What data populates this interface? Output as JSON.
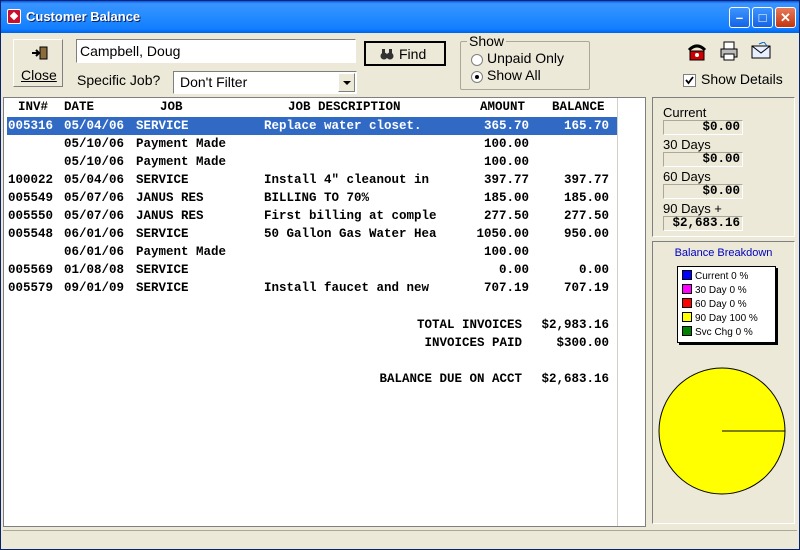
{
  "window": {
    "title": "Customer Balance"
  },
  "toolbar": {
    "close_label": "Close",
    "customer_name": "Campbell, Doug",
    "find_label": "Find",
    "specific_job_label": "Specific Job?",
    "job_filter_value": "Don't Filter",
    "show_group_label": "Show",
    "show_options": [
      "Unpaid Only",
      "Show All"
    ],
    "show_details_label": "Show Details"
  },
  "table": {
    "headers": {
      "inv": "INV#",
      "date": "DATE",
      "job": "JOB",
      "desc": "JOB DESCRIPTION",
      "amount": "AMOUNT",
      "balance": "BALANCE"
    },
    "rows": [
      {
        "inv": "005316",
        "date": "05/04/06",
        "job": "SERVICE",
        "desc": "Replace water closet.",
        "amount": "365.70",
        "balance": "165.70"
      },
      {
        "inv": "",
        "date": "05/10/06",
        "job": "Payment Made",
        "desc": "",
        "amount": "100.00",
        "balance": ""
      },
      {
        "inv": "",
        "date": "05/10/06",
        "job": "Payment Made",
        "desc": "",
        "amount": "100.00",
        "balance": ""
      },
      {
        "inv": "100022",
        "date": "05/04/06",
        "job": "SERVICE",
        "desc": "Install 4\" cleanout in",
        "amount": "397.77",
        "balance": "397.77"
      },
      {
        "inv": "005549",
        "date": "05/07/06",
        "job": "JANUS RES",
        "desc": "BILLING TO 70%",
        "amount": "185.00",
        "balance": "185.00"
      },
      {
        "inv": "005550",
        "date": "05/07/06",
        "job": "JANUS RES",
        "desc": "First billing at comple",
        "amount": "277.50",
        "balance": "277.50"
      },
      {
        "inv": "005548",
        "date": "06/01/06",
        "job": "SERVICE",
        "desc": "50 Gallon Gas Water Hea",
        "amount": "1050.00",
        "balance": "950.00"
      },
      {
        "inv": "",
        "date": "06/01/06",
        "job": "Payment Made",
        "desc": "",
        "amount": "100.00",
        "balance": ""
      },
      {
        "inv": "005569",
        "date": "01/08/08",
        "job": "SERVICE",
        "desc": "",
        "amount": "0.00",
        "balance": "0.00"
      },
      {
        "inv": "005579",
        "date": "09/01/09",
        "job": "SERVICE",
        "desc": "Install faucet and new",
        "amount": "707.19",
        "balance": "707.19"
      }
    ],
    "totals": [
      {
        "label": "TOTAL INVOICES",
        "value": "$2,983.16"
      },
      {
        "label": "INVOICES PAID",
        "value": "$300.00"
      },
      {
        "label": "BALANCE DUE ON ACCT",
        "value": "$2,683.16"
      }
    ]
  },
  "aging": [
    {
      "label": "Current",
      "value": "$0.00"
    },
    {
      "label": "30 Days",
      "value": "$0.00"
    },
    {
      "label": "60 Days",
      "value": "$0.00"
    },
    {
      "label": "90 Days +",
      "value": "$2,683.16"
    }
  ],
  "breakdown": {
    "title": "Balance Breakdown",
    "legend": [
      {
        "label": "Current 0 %",
        "color": "#0000ff"
      },
      {
        "label": "30 Day 0 %",
        "color": "#ff00ff"
      },
      {
        "label": "60 Day 0 %",
        "color": "#ff0000"
      },
      {
        "label": "90 Day 100 %",
        "color": "#ffff00"
      },
      {
        "label": "Svc Chg 0 %",
        "color": "#008000"
      }
    ]
  }
}
